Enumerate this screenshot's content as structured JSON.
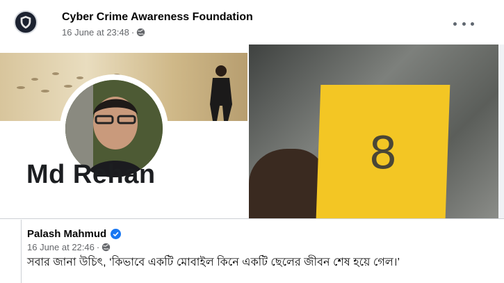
{
  "post": {
    "page_name": "Cyber Crime Awareness Foundation",
    "timestamp": "16 June at 23:48",
    "separator": "·",
    "privacy_icon": "globe-icon",
    "more_icon": "more-options-icon"
  },
  "photos": {
    "left_name_text": "Md Rehan",
    "right_box_number": "8"
  },
  "shared": {
    "author": "Palash Mahmud",
    "verified_icon": "verified-badge-icon",
    "timestamp": "16 June at 22:46",
    "separator": "·",
    "privacy_icon": "globe-icon",
    "text": "সবার জানা উচিৎ, ‘কিভাবে একটি মোবাইল কিনে একটি ছেলের জীবন শেষ হয়ে গেল।’"
  },
  "colors": {
    "accent_blue": "#1877f2",
    "secondary_text": "#65676b",
    "box_yellow": "#f3c624"
  }
}
